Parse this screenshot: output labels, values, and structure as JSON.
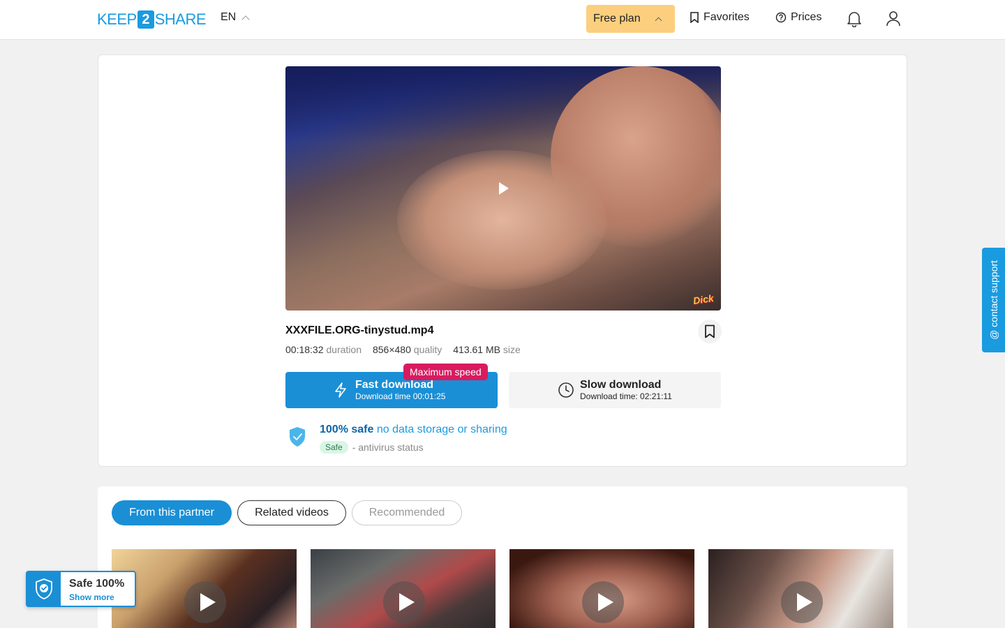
{
  "header": {
    "logo_left": "KEEP",
    "logo_mid": "2",
    "logo_right": "SHARE",
    "lang": "EN",
    "plan": "Free plan",
    "favorites": "Favorites",
    "prices": "Prices"
  },
  "file": {
    "name": "XXXFILE.ORG-tinystud.mp4",
    "duration": "00:18:32",
    "duration_label": "duration",
    "quality": "856×480",
    "quality_label": "quality",
    "size": "413.61 MB",
    "size_label": "size",
    "watermark": "Dick"
  },
  "download": {
    "badge": "Maximum speed",
    "fast_label": "Fast download",
    "fast_time": "Download time 00:01:25",
    "slow_label": "Slow download",
    "slow_time": "Download time: 02:21:11"
  },
  "safety": {
    "bold": "100% safe",
    "text": "no data storage or sharing",
    "status_badge": "Safe",
    "status_text": "- antivirus status"
  },
  "contact_support": "contact support",
  "tabs": [
    "From this partner",
    "Related videos",
    "Recommended"
  ],
  "safe_widget": {
    "title": "Safe 100%",
    "more": "Show more"
  },
  "colors": {
    "accent": "#1a8fd6",
    "plan": "#fbcf7e",
    "badge": "#d81b60"
  }
}
